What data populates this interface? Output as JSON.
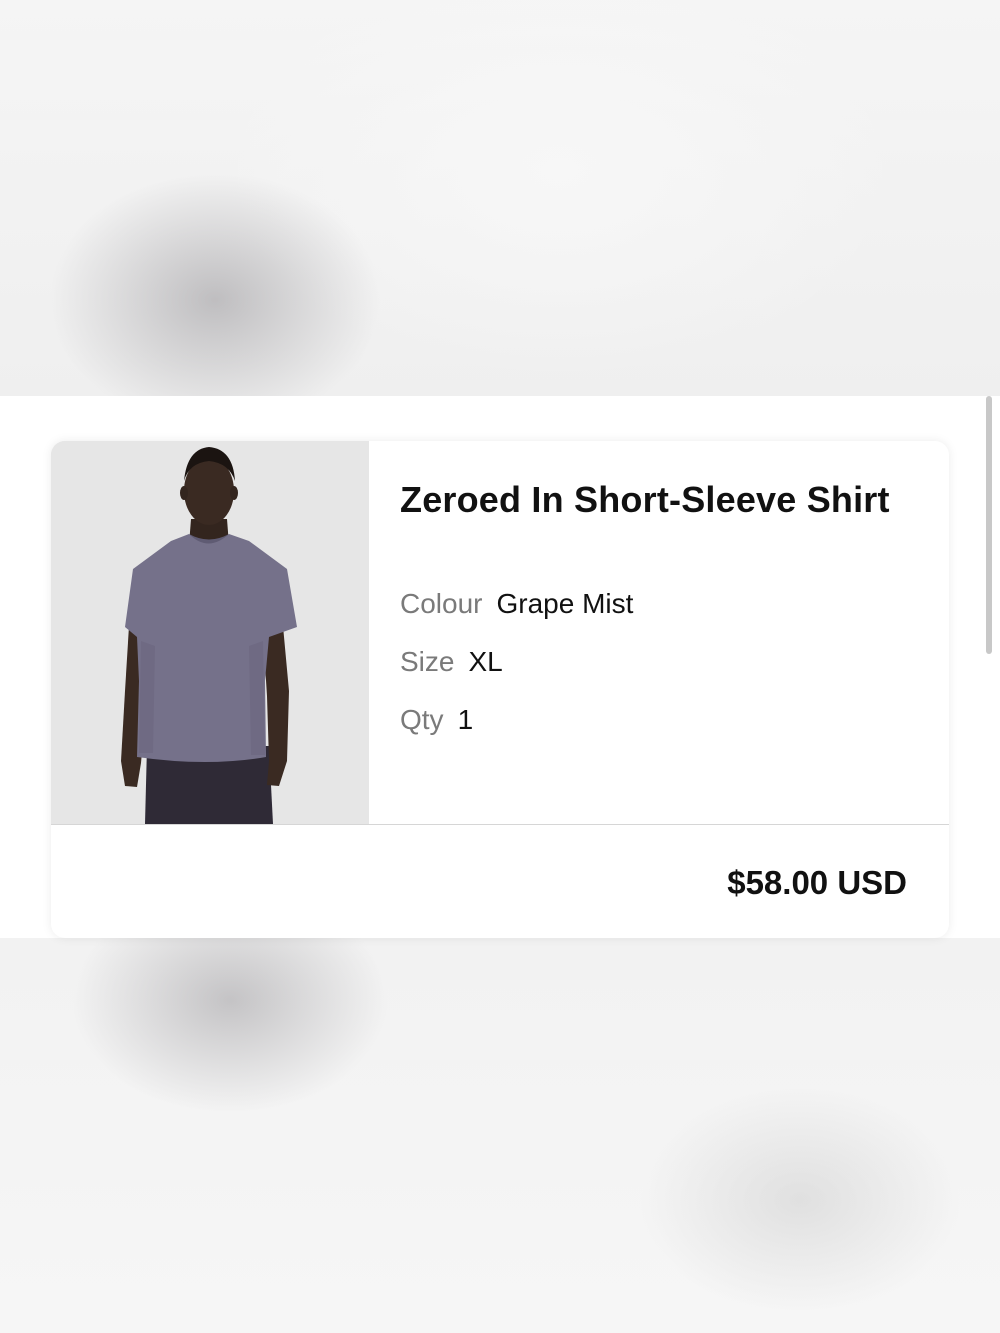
{
  "product": {
    "name": "Zeroed In Short-Sleeve Shirt",
    "image_alt": "Man wearing grape mist short-sleeve shirt",
    "attributes": {
      "colour_label": "Colour",
      "colour_value": "Grape Mist",
      "size_label": "Size",
      "size_value": "XL",
      "qty_label": "Qty",
      "qty_value": "1"
    },
    "price": "$58.00 USD"
  },
  "colors": {
    "shirt": "#75718a",
    "pants": "#2f2a36",
    "skin": "#3a2a22",
    "image_bg": "#e6e6e6"
  }
}
